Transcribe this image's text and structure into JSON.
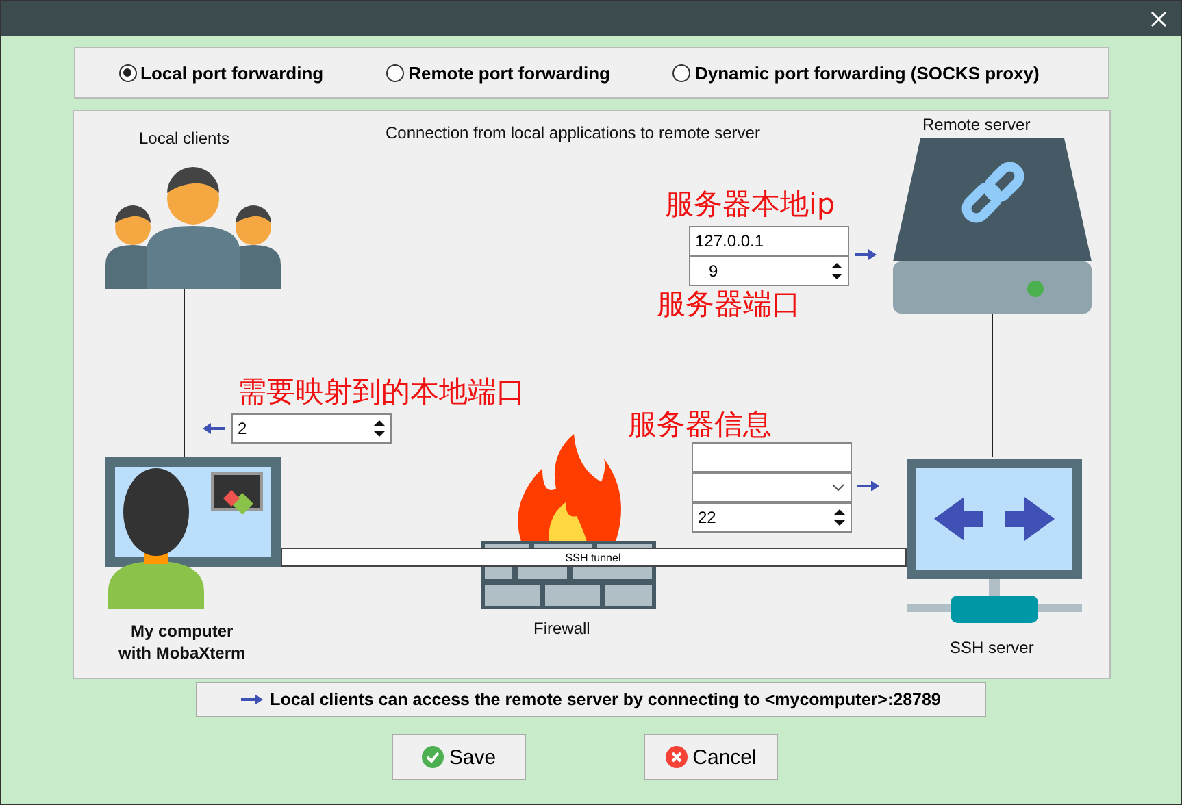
{
  "modes": [
    {
      "label": "Local port forwarding",
      "selected": true
    },
    {
      "label": "Remote port forwarding",
      "selected": false
    },
    {
      "label": "Dynamic port forwarding (SOCKS proxy)",
      "selected": false
    }
  ],
  "diagram": {
    "caption": "Connection from local applications to remote server",
    "local_clients_label": "Local clients",
    "remote_server_label": "Remote server",
    "my_computer_label": "My computer\nwith MobaXterm",
    "firewall_label": "Firewall",
    "ssh_server_label": "SSH server",
    "tunnel_label": "SSH tunnel"
  },
  "fields": {
    "remote_host": "127.0.0.1",
    "remote_port": "9",
    "local_port": "2",
    "ssh_port": "22"
  },
  "annotations": [
    {
      "text": "服务器本地ip"
    },
    {
      "text": "服务器端口"
    },
    {
      "text": "需要映射到的本地端口"
    },
    {
      "text": "服务器信息"
    }
  ],
  "info": "Local clients can access the remote server by connecting to <mycomputer>:28789",
  "buttons": [
    {
      "label": "Save",
      "kind": "save"
    },
    {
      "label": "Cancel",
      "kind": "cancel"
    }
  ]
}
